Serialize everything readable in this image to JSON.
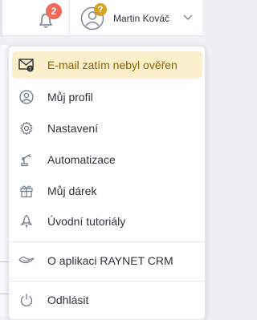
{
  "topbar": {
    "notifications_count": "2",
    "user_warning_badge": "?",
    "user_name": "Martin Kováč"
  },
  "menu": {
    "warning_item": "E-mail zatím nebyl ověřen",
    "items": [
      {
        "label": "Můj profil",
        "icon": "user-circle-icon"
      },
      {
        "label": "Nastavení",
        "icon": "gear-icon"
      },
      {
        "label": "Automatizace",
        "icon": "robot-arm-icon"
      },
      {
        "label": "Můj dárek",
        "icon": "gift-icon"
      },
      {
        "label": "Úvodní tutoriály",
        "icon": "rocket-icon"
      }
    ],
    "about_item": "O aplikaci RAYNET CRM",
    "logout_item": "Odhlásit"
  },
  "colors": {
    "warning_bg": "#fbefcc",
    "warning_text": "#8a6304",
    "notification_badge": "#ef6a5a",
    "warning_badge": "#d7a21f"
  }
}
